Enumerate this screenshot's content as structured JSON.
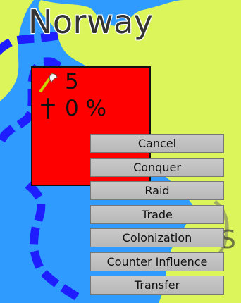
{
  "map": {
    "title": "Norway",
    "partial_label": "S",
    "colors": {
      "sea": "#2f9bff",
      "land": "#dcf55a",
      "border": "#1d1dff",
      "province": "#ff0000"
    }
  },
  "unit": {
    "army_icon": "axe-icon",
    "army_value": "5",
    "religion_icon": "cross-icon",
    "religion_value": "0 %"
  },
  "actions": [
    {
      "label": "Cancel"
    },
    {
      "label": "Conquer"
    },
    {
      "label": "Raid"
    },
    {
      "label": "Trade"
    },
    {
      "label": "Colonization"
    },
    {
      "label": "Counter Influence"
    },
    {
      "label": "Transfer"
    }
  ]
}
